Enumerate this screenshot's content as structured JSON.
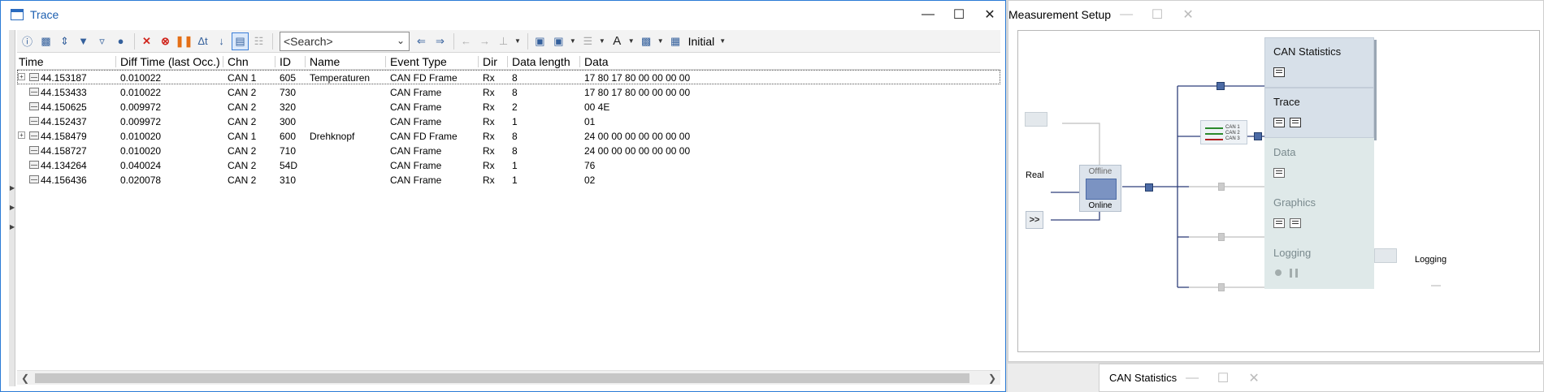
{
  "trace": {
    "title": "Trace",
    "search_placeholder": "<Search>",
    "filter_label": "Initial",
    "columns": [
      "Time",
      "Diff Time (last Occ.)",
      "Chn",
      "ID",
      "Name",
      "Event Type",
      "Dir",
      "Data length",
      "Data"
    ],
    "rows": [
      {
        "expandable": true,
        "time": "44.153187",
        "diff": "0.010022",
        "chn": "CAN 1",
        "id": "605",
        "name": "Temperaturen",
        "type": "CAN FD Frame",
        "dir": "Rx",
        "len": "8",
        "data": "17  80  17  80  00  00  00  00"
      },
      {
        "expandable": false,
        "time": "44.153433",
        "diff": "0.010022",
        "chn": "CAN 2",
        "id": "730",
        "name": "",
        "type": "CAN Frame",
        "dir": "Rx",
        "len": "8",
        "data": "17  80  17  80  00  00  00  00"
      },
      {
        "expandable": false,
        "time": "44.150625",
        "diff": "0.009972",
        "chn": "CAN 2",
        "id": "320",
        "name": "",
        "type": "CAN Frame",
        "dir": "Rx",
        "len": "2",
        "data": "00  4E"
      },
      {
        "expandable": false,
        "time": "44.152437",
        "diff": "0.009972",
        "chn": "CAN 2",
        "id": "300",
        "name": "",
        "type": "CAN Frame",
        "dir": "Rx",
        "len": "1",
        "data": "01"
      },
      {
        "expandable": true,
        "time": "44.158479",
        "diff": "0.010020",
        "chn": "CAN 1",
        "id": "600",
        "name": "Drehknopf",
        "type": "CAN FD Frame",
        "dir": "Rx",
        "len": "8",
        "data": "24  00  00  00  00  00  00  00"
      },
      {
        "expandable": false,
        "time": "44.158727",
        "diff": "0.010020",
        "chn": "CAN 2",
        "id": "710",
        "name": "",
        "type": "CAN Frame",
        "dir": "Rx",
        "len": "8",
        "data": "24  00  00  00  00  00  00  00"
      },
      {
        "expandable": false,
        "time": "44.134264",
        "diff": "0.040024",
        "chn": "CAN 2",
        "id": "54D",
        "name": "",
        "type": "CAN Frame",
        "dir": "Rx",
        "len": "1",
        "data": "76"
      },
      {
        "expandable": false,
        "time": "44.156436",
        "diff": "0.020078",
        "chn": "CAN 2",
        "id": "310",
        "name": "",
        "type": "CAN Frame",
        "dir": "Rx",
        "len": "1",
        "data": "02"
      }
    ]
  },
  "measurement": {
    "title": "Measurement Setup",
    "real_label": "Real",
    "real_button": ">>",
    "offline_label": "Offline",
    "online_label": "Online",
    "filter_channels": [
      "CAN 1",
      "CAN 2",
      "CAN 3"
    ],
    "blocks": {
      "can_statistics": "CAN Statistics",
      "trace": "Trace",
      "data": "Data",
      "graphics": "Graphics",
      "logging": "Logging"
    },
    "logging_file_label": "Logging"
  },
  "can_statistics_window": {
    "title": "CAN Statistics"
  },
  "colors": {
    "accent": "#1c5fb0",
    "selected_border": "#3c7fd8",
    "node": "#4b6aa5"
  }
}
